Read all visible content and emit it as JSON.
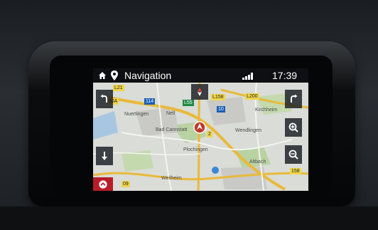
{
  "status_bar": {
    "title": "Navigation",
    "time": "17:39"
  },
  "map": {
    "road_labels": [
      "L21",
      "30A",
      "114",
      "L55",
      "L158",
      "L200",
      "10",
      "2",
      "158",
      "09"
    ],
    "place_labels": [
      "Nuertingen",
      "Nell",
      "Kirchheim",
      "Bad Cannstatt",
      "Wendlingen",
      "Plochingen",
      "Weilheim",
      "Altbach"
    ]
  },
  "icons": {
    "home": "home-icon",
    "nav": "navigation-icon",
    "signal": "signal-icon",
    "zoom_in": "zoom-in-icon",
    "zoom_out": "zoom-out-icon",
    "turn_left": "turn-left-arrow-icon",
    "turn_right": "turn-right-arrow-icon",
    "down": "down-arrow-icon",
    "compass": "compass-icon",
    "position": "vehicle-position-icon",
    "collapse": "chevron-up-icon"
  },
  "colors": {
    "accent_red": "#b81d2a",
    "bar": "#0d0f12",
    "map_bg": "#d7dad6",
    "road_yellow": "#e9b93a"
  }
}
